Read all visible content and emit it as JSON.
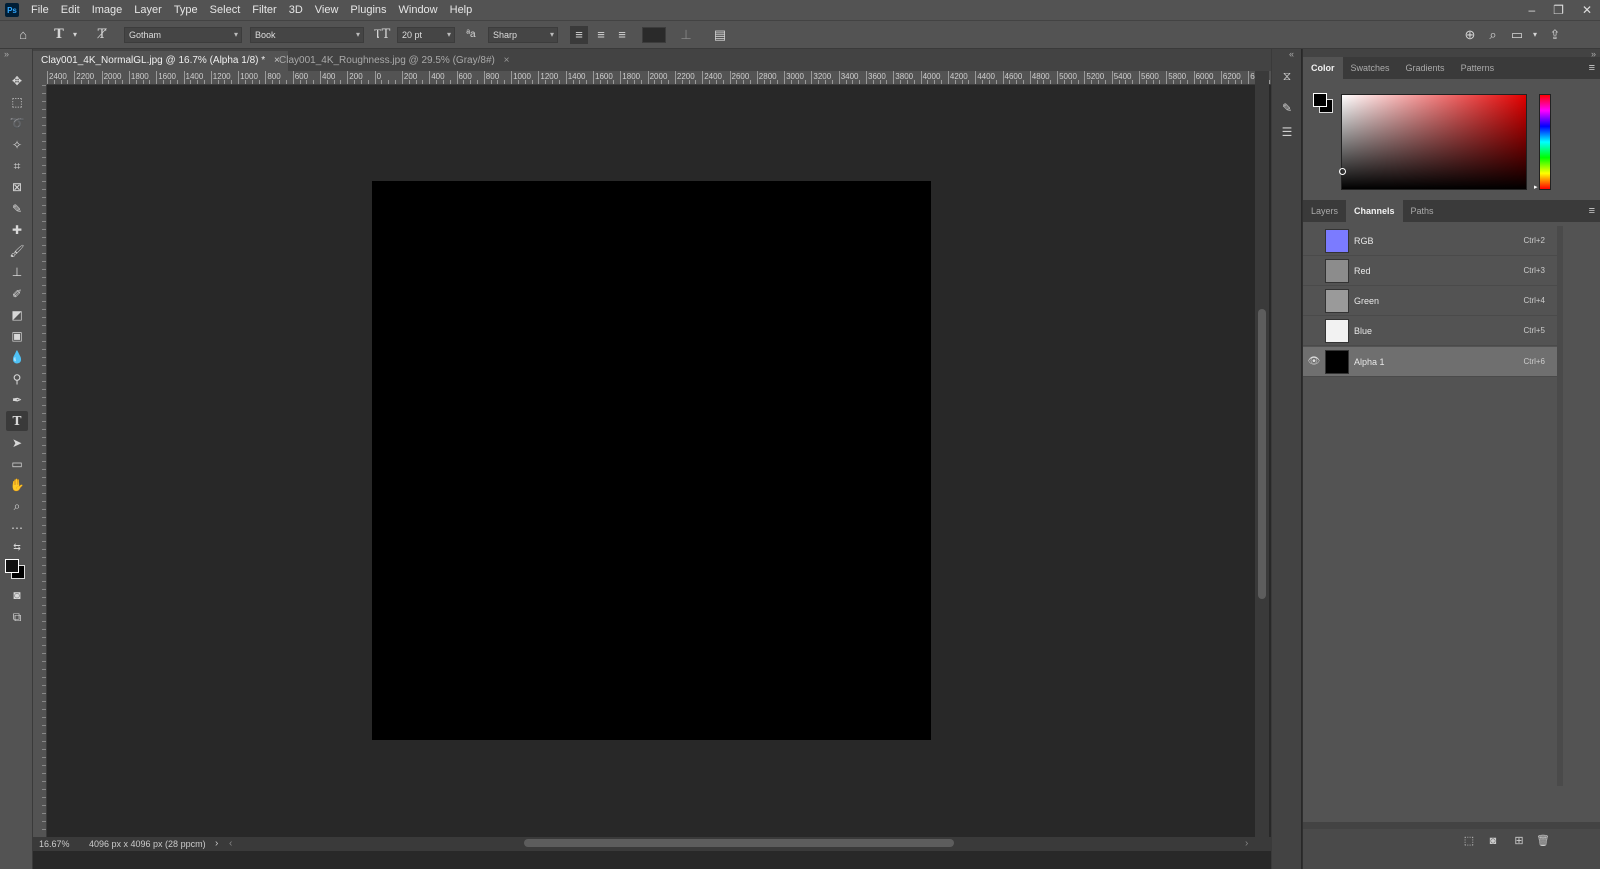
{
  "app": {
    "logo": "Ps"
  },
  "menu": [
    "File",
    "Edit",
    "Image",
    "Layer",
    "Type",
    "Select",
    "Filter",
    "3D",
    "View",
    "Plugins",
    "Window",
    "Help"
  ],
  "options": {
    "font_family": "Gotham",
    "font_style": "Book",
    "font_size": "20 pt",
    "antialias": "Sharp",
    "aa_glyph": "ªa"
  },
  "tabs": [
    {
      "label": "Clay001_4K_NormalGL.jpg @ 16.7% (Alpha 1/8) *",
      "close": "×"
    },
    {
      "label": "Clay001_4K_Roughness.jpg @ 29.5% (Gray/8#)",
      "close": "×"
    }
  ],
  "ruler": [
    "2400",
    "2200",
    "2000",
    "1800",
    "1600",
    "1400",
    "1200",
    "1000",
    "800",
    "600",
    "400",
    "200",
    "0",
    "200",
    "400",
    "600",
    "800",
    "1000",
    "1200",
    "1400",
    "1600",
    "1800",
    "2000",
    "2200",
    "2400",
    "2600",
    "2800",
    "3000",
    "3200",
    "3400",
    "3600",
    "3800",
    "4000",
    "4200",
    "4400",
    "4600",
    "4800",
    "5000",
    "5200",
    "5400",
    "5600",
    "5800",
    "6000",
    "6200",
    "64"
  ],
  "status": {
    "zoom": "16.67%",
    "doc_info": "4096 px x 4096 px (28 ppcm)"
  },
  "panels": {
    "color_tabs": [
      "Color",
      "Swatches",
      "Gradients",
      "Patterns"
    ],
    "layer_tabs": [
      "Layers",
      "Channels",
      "Paths"
    ],
    "channels": [
      {
        "name": "RGB",
        "shortcut": "Ctrl+2",
        "thumb": "#7b7bff"
      },
      {
        "name": "Red",
        "shortcut": "Ctrl+3",
        "thumb": "#8c8c8c"
      },
      {
        "name": "Green",
        "shortcut": "Ctrl+4",
        "thumb": "#9a9a9a"
      },
      {
        "name": "Blue",
        "shortcut": "Ctrl+5",
        "thumb": "#f2f2f2"
      },
      {
        "name": "Alpha 1",
        "shortcut": "Ctrl+6",
        "thumb": "#000000"
      }
    ]
  }
}
